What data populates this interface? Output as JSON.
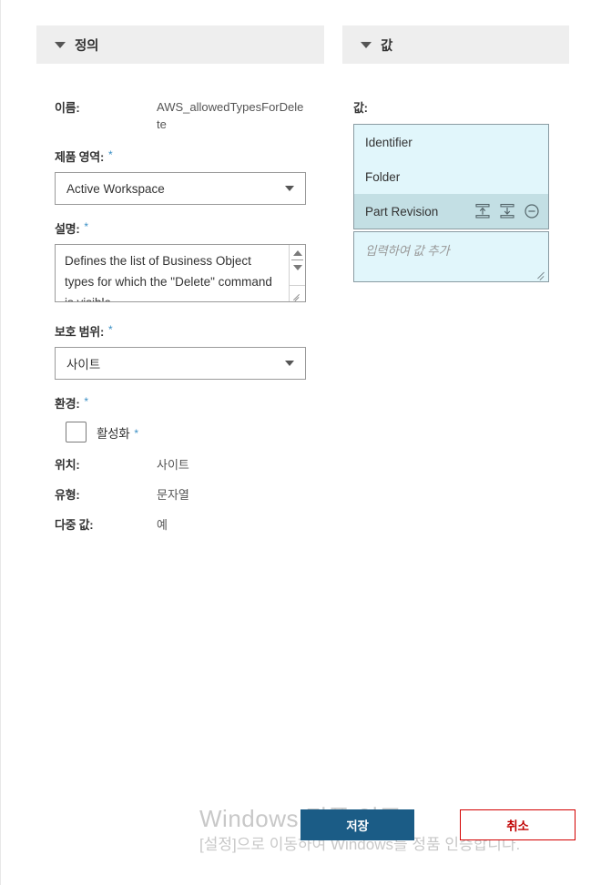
{
  "panels": {
    "definition": {
      "title": "정의",
      "name": {
        "label": "이름:",
        "value": "AWS_allowedTypesForDelete"
      },
      "product_area": {
        "label": "제품 영역:",
        "required": "*",
        "value": "Active Workspace"
      },
      "description": {
        "label": "설명:",
        "required": "*",
        "value": "Defines the list of Business Object types for which the \"Delete\" command is visible."
      },
      "protection_scope": {
        "label": "보호 범위:",
        "required": "*",
        "value": "사이트"
      },
      "environment": {
        "label": "환경:",
        "required": "*",
        "checkbox_label": "활성화",
        "checkbox_required": "*",
        "checked": false
      },
      "info_rows": [
        {
          "key": "위치:",
          "value": "사이트"
        },
        {
          "key": "유형:",
          "value": "문자열"
        },
        {
          "key": "다중 값:",
          "value": "예"
        }
      ]
    },
    "values": {
      "title": "값",
      "list_label": "값:",
      "items": [
        {
          "text": "Identifier",
          "selected": false
        },
        {
          "text": "Folder",
          "selected": false
        },
        {
          "text": "Part Revision",
          "selected": true
        }
      ],
      "row_actions": [
        "move-up-icon",
        "move-down-icon",
        "remove-icon"
      ],
      "input_placeholder": "입력하여 값 추가"
    }
  },
  "buttons": {
    "save": "저장",
    "cancel": "취소"
  },
  "watermark": {
    "line1": "Windows 정품 인증",
    "line2": "[설정]으로 이동하여 Windows를 정품 인증합니다."
  },
  "colors": {
    "accent_blue": "#3a8fc4",
    "save_button_bg": "#1b5c86",
    "cancel_button_border": "#d40000",
    "cancel_button_text": "#c00000",
    "panel_header_bg": "#eeeeee",
    "value_list_bg": "#e1f6fb",
    "value_selected_bg": "#c3dfe4"
  }
}
